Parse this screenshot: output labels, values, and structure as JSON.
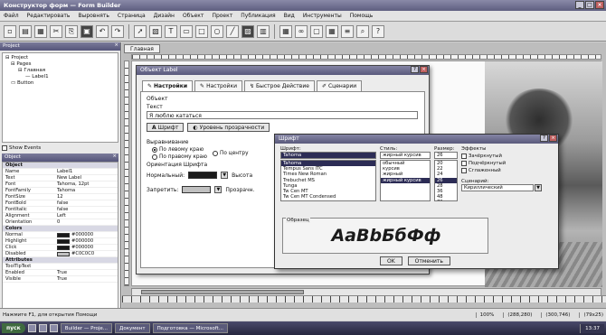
{
  "window": {
    "title": "Конструктор форм — Form Builder",
    "buttons": [
      "_",
      "□",
      "×"
    ]
  },
  "menu": [
    "Файл",
    "Редактировать",
    "Выровнять",
    "Страница",
    "Дизайн",
    "Объект",
    "Проект",
    "Публикация",
    "Вид",
    "Инструменты",
    "Помощь"
  ],
  "toolbar": {
    "icons": [
      "new-icon",
      "open-icon",
      "save-icon",
      "cut-icon",
      "copy-icon",
      "paste-icon",
      "undo-icon",
      "redo-icon",
      "pointer-icon",
      "image-icon",
      "text-icon",
      "button-icon",
      "rectangle-icon",
      "ellipse-icon",
      "line-icon",
      "picture-icon",
      "chart-icon",
      "table-icon",
      "link-icon",
      "panel-icon",
      "grid-icon",
      "align-icon",
      "zoom-icon",
      "help-icon"
    ],
    "glyphs": [
      "▫",
      "▤",
      "▦",
      "✂",
      "⎘",
      "▣",
      "↶",
      "↷",
      "➚",
      "▧",
      "T",
      "▭",
      "□",
      "○",
      "╱",
      "▨",
      "▥",
      "▦",
      "∞",
      "▢",
      "▦",
      "≡",
      "⌕",
      "?"
    ]
  },
  "left_panel": {
    "header": "Project",
    "tree": [
      "Project",
      "Pages",
      "Главная",
      "Label1",
      "Button"
    ],
    "show_events": "Show Events",
    "props_header": "Object",
    "props": [
      {
        "k": "Object",
        "v": "",
        "section": true
      },
      {
        "k": "Name",
        "v": "Label1"
      },
      {
        "k": "Text",
        "v": "New Label"
      },
      {
        "k": "Font",
        "v": "Tahoma, 12pt"
      },
      {
        "k": "FontFamily",
        "v": "Tahoma"
      },
      {
        "k": "FontSize",
        "v": "12"
      },
      {
        "k": "FontBold",
        "v": "false"
      },
      {
        "k": "FontItalic",
        "v": "false"
      },
      {
        "k": "Alignment",
        "v": "Left"
      },
      {
        "k": "Orientation",
        "v": "0"
      },
      {
        "k": "Colors",
        "v": "",
        "section": true
      },
      {
        "k": "Normal",
        "v": "#000000",
        "swatch": "#1a1a1a"
      },
      {
        "k": "Highlight",
        "v": "#000000",
        "swatch": "#1a1a1a"
      },
      {
        "k": "Click",
        "v": "#000000",
        "swatch": "#1a1a1a"
      },
      {
        "k": "Disabled",
        "v": "#C0C0C0",
        "swatch": "#c0c0c0"
      },
      {
        "k": "Attributes",
        "v": "",
        "section": true
      },
      {
        "k": "ToolTipText",
        "v": ""
      },
      {
        "k": "Enabled",
        "v": "True"
      },
      {
        "k": "Visible",
        "v": "True"
      }
    ]
  },
  "document_tab": "Главная",
  "dialog1": {
    "title": "Объект Label",
    "tabs": [
      "Настройки",
      "Настройки",
      "Быстрое Действие",
      "Сценарии"
    ],
    "group_label": "Объект",
    "text_label": "Текст",
    "text_value": "Я люблю кататься",
    "font_button": "Шрифт",
    "transparency_button": "Уровень прозрачности",
    "alignment_label": "Выравнивание",
    "radios": [
      "По левому краю",
      "По правому краю",
      "По центру"
    ],
    "orientation_label": "Ориентация Шрифта",
    "normal_label": "Нормальный:",
    "height_label": "Высота",
    "disabled_label": "Запретить:",
    "other_label": "Прозрачн."
  },
  "font_dialog": {
    "title": "Шрифт",
    "font_label": "Шрифт:",
    "font_value": "Tahoma",
    "fonts": [
      "Tahoma",
      "Tempus Sans ITC",
      "Times New Roman",
      "Trebuchet MS",
      "Tunga",
      "Tw Cen MT",
      "Tw Cen MT Condensed"
    ],
    "style_label": "Стиль:",
    "style_value": "жирный курсив",
    "styles": [
      "обычный",
      "курсив",
      "жирный",
      "жирный курсив"
    ],
    "size_label": "Размер:",
    "size_value": "26",
    "sizes": [
      "20",
      "22",
      "24",
      "26",
      "28",
      "36",
      "48",
      "72"
    ],
    "effects_label": "Эффекты",
    "effects": [
      "Зачёркнутый",
      "Подчёркнутый",
      "Сглаженный"
    ],
    "script_label": "Сценарий:",
    "script_value": "Кириллический",
    "preview_label": "Образец",
    "preview_text": "AaBbБбФф",
    "ok_label": "OK",
    "cancel_label": "Отменить"
  },
  "status": {
    "text": "Нажмите F1, для открытия Помощи",
    "cells": [
      "100%",
      "(288,280)",
      "(300,746)",
      "(79x25)"
    ]
  },
  "taskbar": {
    "start": "пуск",
    "tasks": [
      "Builder — Proje...",
      "Документ",
      "Подготовка — Microsoft..."
    ],
    "clock": "13:37"
  }
}
